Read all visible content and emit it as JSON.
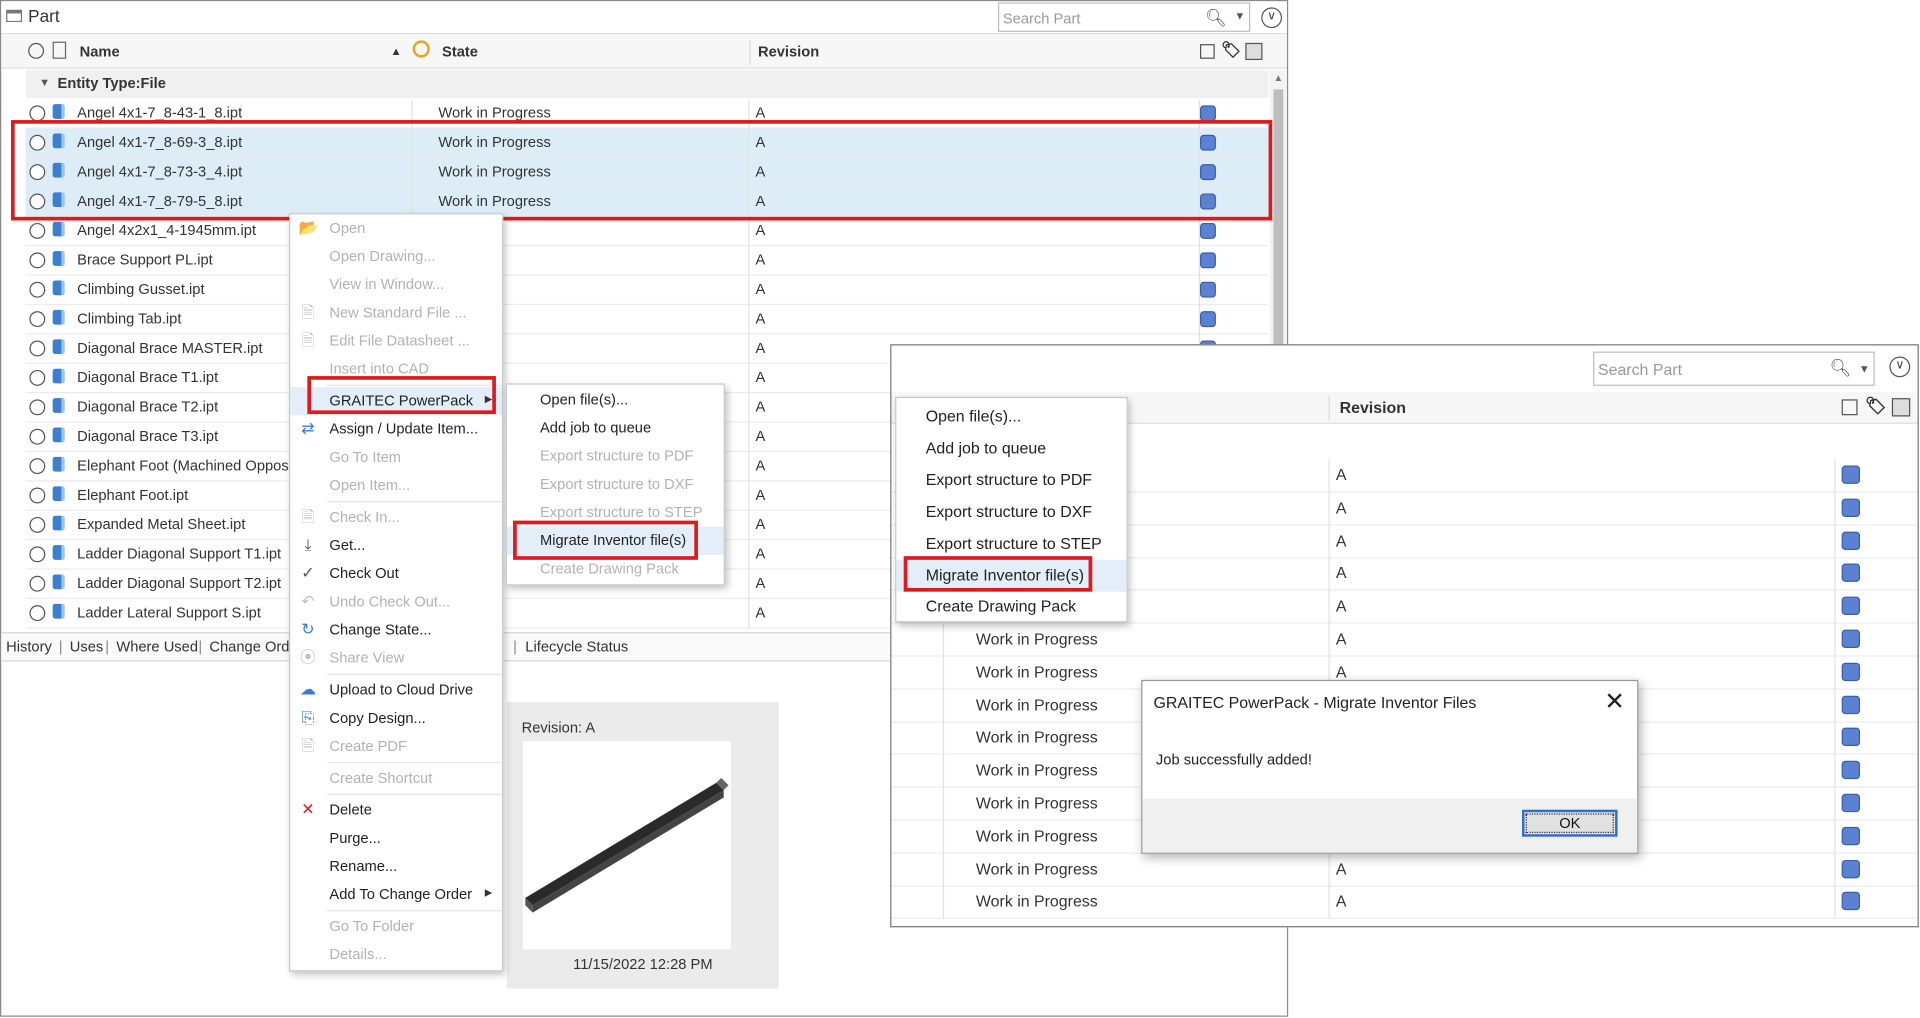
{
  "window": {
    "title": "Part",
    "search_placeholder": "Search Part",
    "columns": {
      "name": "Name",
      "state": "State",
      "revision": "Revision"
    },
    "group_label": "Entity Type:File"
  },
  "rows": [
    {
      "name": "Angel 4x1-7_8-43-1_8.ipt",
      "state": "Work in Progress",
      "revision": "A"
    },
    {
      "name": "Angel 4x1-7_8-69-3_8.ipt",
      "state": "Work in Progress",
      "revision": "A"
    },
    {
      "name": "Angel 4x1-7_8-73-3_4.ipt",
      "state": "Work in Progress",
      "revision": "A"
    },
    {
      "name": "Angel 4x1-7_8-79-5_8.ipt",
      "state": "Work in Progress",
      "revision": "A"
    },
    {
      "name": "Angel 4x2x1_4-1945mm.ipt",
      "state": "ogress",
      "revision": "A"
    },
    {
      "name": "Brace Support PL.ipt",
      "state": "ogress",
      "revision": "A"
    },
    {
      "name": "Climbing Gusset.ipt",
      "state": "ogress",
      "revision": "A"
    },
    {
      "name": "Climbing Tab.ipt",
      "state": "ogress",
      "revision": "A"
    },
    {
      "name": "Diagonal Brace MASTER.ipt",
      "state": "ogress",
      "revision": "A"
    },
    {
      "name": "Diagonal Brace T1.ipt",
      "state": "ogress",
      "revision": "A"
    },
    {
      "name": "Diagonal Brace T2.ipt",
      "state": "",
      "revision": "A"
    },
    {
      "name": "Diagonal Brace T3.ipt",
      "state": "",
      "revision": "A"
    },
    {
      "name": "Elephant Foot (Machined Opposit)",
      "state": "",
      "revision": "A"
    },
    {
      "name": "Elephant Foot.ipt",
      "state": "",
      "revision": "A"
    },
    {
      "name": "Expanded Metal Sheet.ipt",
      "state": "",
      "revision": "A"
    },
    {
      "name": "Ladder Diagonal Support T1.ipt",
      "state": "",
      "revision": "A"
    },
    {
      "name": "Ladder Diagonal Support T2.ipt",
      "state": "",
      "revision": "A"
    },
    {
      "name": "Ladder Lateral Support S.ipt",
      "state": "ogress",
      "revision": "A"
    }
  ],
  "bottom_tabs": [
    "History",
    "Uses",
    "Where Used",
    "Change Orde",
    "Lifecycle Status"
  ],
  "preview": {
    "revision_label": "Revision:",
    "revision_value": "A",
    "date": "11/15/2022 12:28 PM"
  },
  "context_menu": [
    {
      "label": "Open",
      "enabled": false
    },
    {
      "label": "Open Drawing...",
      "enabled": false
    },
    {
      "label": "View in Window...",
      "enabled": false
    },
    {
      "label": "New Standard File ...",
      "enabled": false
    },
    {
      "label": "Edit File Datasheet ...",
      "enabled": false
    },
    {
      "label": "Insert into CAD",
      "enabled": false
    },
    {
      "label": "GRAITEC PowerPack",
      "enabled": true,
      "submenu": true
    },
    {
      "label": "Assign / Update Item...",
      "enabled": true
    },
    {
      "label": "Go To Item",
      "enabled": false
    },
    {
      "label": "Open Item...",
      "enabled": false
    },
    {
      "label": "Check In...",
      "enabled": false
    },
    {
      "label": "Get...",
      "enabled": true
    },
    {
      "label": "Check Out",
      "enabled": true
    },
    {
      "label": "Undo Check Out...",
      "enabled": false
    },
    {
      "label": "Change State...",
      "enabled": true
    },
    {
      "label": "Share View",
      "enabled": false
    },
    {
      "label": "Upload to Cloud Drive",
      "enabled": true
    },
    {
      "label": "Copy Design...",
      "enabled": true
    },
    {
      "label": "Create PDF",
      "enabled": false
    },
    {
      "label": "Create Shortcut",
      "enabled": false
    },
    {
      "label": "Delete",
      "enabled": true
    },
    {
      "label": "Purge...",
      "enabled": true
    },
    {
      "label": "Rename...",
      "enabled": true
    },
    {
      "label": "Add To Change Order",
      "enabled": true,
      "submenu": true
    },
    {
      "label": "Go To Folder",
      "enabled": false
    },
    {
      "label": "Details...",
      "enabled": false
    }
  ],
  "submenu": [
    {
      "label": "Open file(s)...",
      "enabled": true
    },
    {
      "label": "Add job to queue",
      "enabled": true
    },
    {
      "label": "Export structure to PDF",
      "enabled": false
    },
    {
      "label": "Export structure to DXF",
      "enabled": false
    },
    {
      "label": "Export structure to STEP",
      "enabled": false
    },
    {
      "label": "Migrate Inventor file(s)",
      "enabled": true
    },
    {
      "label": "Create Drawing Pack",
      "enabled": false
    }
  ],
  "zoom": {
    "search_placeholder": "Search Part",
    "revision_header": "Revision",
    "menu": [
      "Open file(s)...",
      "Add job to queue",
      "Export structure to PDF",
      "Export structure to DXF",
      "Export structure to STEP",
      "Migrate Inventor file(s)",
      "Create Drawing Pack"
    ],
    "rows": [
      {
        "state": "",
        "revision": "A"
      },
      {
        "state": "",
        "revision": "A"
      },
      {
        "state": "",
        "revision": "A"
      },
      {
        "state": "",
        "revision": "A"
      },
      {
        "state": "",
        "revision": "A"
      },
      {
        "state": "Work in Progress",
        "revision": "A"
      },
      {
        "state": "Work in Progress",
        "revision": "A"
      },
      {
        "state": "Work in Progress",
        "revision": ""
      },
      {
        "state": "Work in Progress",
        "revision": ""
      },
      {
        "state": "Work in Progress",
        "revision": ""
      },
      {
        "state": "Work in Progress",
        "revision": ""
      },
      {
        "state": "Work in Progress",
        "revision": ""
      },
      {
        "state": "Work in Progress",
        "revision": "A"
      },
      {
        "state": "Work in Progress",
        "revision": "A"
      }
    ]
  },
  "dialog": {
    "title": "GRAITEC PowerPack - Migrate Inventor Files",
    "message": "Job successfully added!",
    "ok_label": "OK"
  },
  "colors": {
    "highlight": "#e0191f",
    "selection": "#dcedf7",
    "state_box": "#5b82d2"
  }
}
